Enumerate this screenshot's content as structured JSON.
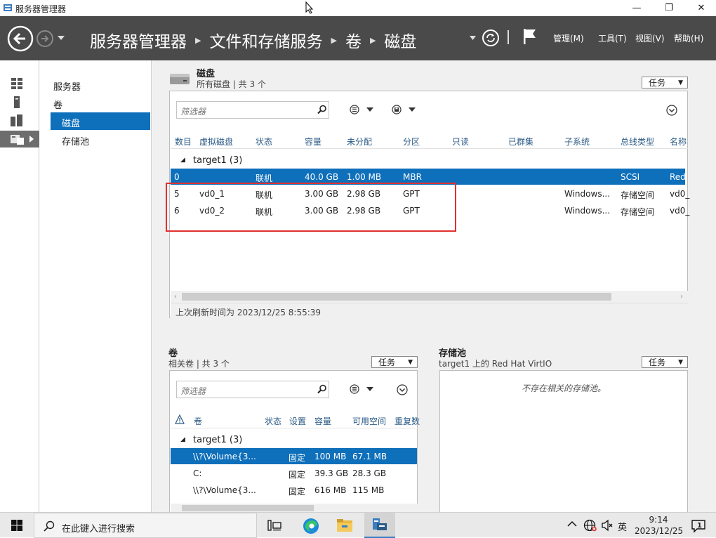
{
  "window": {
    "title": "服务器管理器",
    "minimize": "—",
    "maximize": "❐",
    "close": "✕"
  },
  "header": {
    "breadcrumbs": [
      "服务器管理器",
      "文件和存储服务",
      "卷",
      "磁盘"
    ],
    "menus": {
      "manage": "管理(M)",
      "tools": "工具(T)",
      "view": "视图(V)",
      "help": "帮助(H)"
    }
  },
  "nav": {
    "servers": "服务器",
    "volumes": "卷",
    "disks": "磁盘",
    "pools": "存储池"
  },
  "disks_panel": {
    "title": "磁盘",
    "subtitle": "所有磁盘 | 共 3 个",
    "tasks_label": "任务",
    "filter_placeholder": "筛选器",
    "columns": [
      "数目",
      "虚拟磁盘",
      "状态",
      "容量",
      "未分配",
      "分区",
      "只读",
      "已群集",
      "子系统",
      "总线类型",
      "名称"
    ],
    "group": "target1 (3)",
    "rows": [
      {
        "num": "0",
        "vdisk": "",
        "status": "联机",
        "capacity": "40.0 GB",
        "unalloc": "1.00 MB",
        "partition": "MBR",
        "subsystem": "",
        "bus": "SCSI",
        "name": "Red",
        "selected": true
      },
      {
        "num": "5",
        "vdisk": "vd0_1",
        "status": "联机",
        "capacity": "3.00 GB",
        "unalloc": "2.98 GB",
        "partition": "GPT",
        "subsystem": "Windows...",
        "bus": "存储空间",
        "name": "vd0_",
        "selected": false
      },
      {
        "num": "6",
        "vdisk": "vd0_2",
        "status": "联机",
        "capacity": "3.00 GB",
        "unalloc": "2.98 GB",
        "partition": "GPT",
        "subsystem": "Windows...",
        "bus": "存储空间",
        "name": "vd0_",
        "selected": false
      }
    ],
    "last_refresh": "上次刷新时间为 2023/12/25 8:55:39"
  },
  "volumes_panel": {
    "title": "卷",
    "subtitle": "相关卷 | 共 3 个",
    "tasks_label": "任务",
    "filter_placeholder": "筛选器",
    "columns": [
      "卷",
      "状态",
      "设置",
      "容量",
      "可用空间",
      "重复数"
    ],
    "group": "target1 (3)",
    "rows": [
      {
        "volume": "\\\\?\\Volume{3...",
        "status": "",
        "setting": "固定",
        "capacity": "100 MB",
        "free": "67.1 MB",
        "selected": true
      },
      {
        "volume": "C:",
        "status": "",
        "setting": "固定",
        "capacity": "39.3 GB",
        "free": "28.3 GB",
        "selected": false
      },
      {
        "volume": "\\\\?\\Volume{3...",
        "status": "",
        "setting": "固定",
        "capacity": "616 MB",
        "free": "115 MB",
        "selected": false
      }
    ]
  },
  "pools_panel": {
    "title": "存储池",
    "subtitle": "target1 上的 Red Hat VirtIO",
    "tasks_label": "任务",
    "empty_message": "不存在相关的存储池。"
  },
  "taskbar": {
    "search_placeholder": "在此键入进行搜索",
    "ime": "英",
    "time": "9:14",
    "date": "2023/12/25",
    "notification_count": "1"
  },
  "colors": {
    "accent": "#0e6fba",
    "header": "#4a4a4a",
    "highlight_box": "#e03030"
  }
}
